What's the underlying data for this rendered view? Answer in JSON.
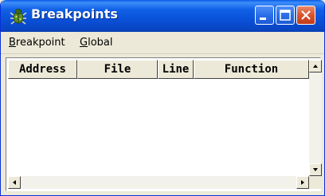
{
  "window": {
    "title": "Breakpoints",
    "title_icon": "bug-icon",
    "buttons": [
      "minimize",
      "maximize",
      "close"
    ]
  },
  "menu": {
    "breakpoint": {
      "accel": "B",
      "rest": "reakpoint"
    },
    "global": {
      "accel": "G",
      "rest": "lobal"
    }
  },
  "table": {
    "columns": [
      "Address",
      "File",
      "Line",
      "Function"
    ],
    "rows": []
  },
  "colors": {
    "titlebar": "#0a52d9",
    "close_button": "#d9532c",
    "face": "#ece9d8"
  }
}
